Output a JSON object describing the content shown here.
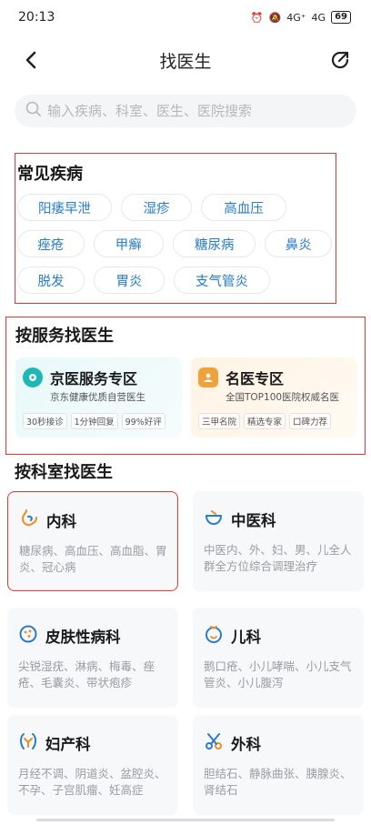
{
  "status_bar": {
    "time": "20:13",
    "battery": "69",
    "signal_a": "4G⁺",
    "signal_b": "4G"
  },
  "nav": {
    "title": "找医生"
  },
  "search": {
    "placeholder": "输入疾病、科室、医生、医院搜索"
  },
  "diseases": {
    "title": "常见疾病",
    "rows": [
      [
        "阳痿早泄",
        "湿疹",
        "高血压"
      ],
      [
        "痤疮",
        "甲癣",
        "糖尿病",
        "鼻炎"
      ],
      [
        "脱发",
        "胃炎",
        "支气管炎"
      ]
    ]
  },
  "service": {
    "title": "按服务找医生",
    "cards": [
      {
        "name": "京医服务专区",
        "sub": "京东健康优质自营医生",
        "tags": [
          "30秒接诊",
          "1分钟回复",
          "99%好评"
        ]
      },
      {
        "name": "名医专区",
        "sub": "全国TOP100医院权威名医",
        "tags": [
          "三甲名院",
          "精选专家",
          "口碑力荐"
        ]
      }
    ]
  },
  "departments": {
    "title": "按科室找医生",
    "items": [
      {
        "name": "内科",
        "desc": "糖尿病、高血压、高血脂、胃炎、冠心病",
        "icon": "stomach-icon"
      },
      {
        "name": "中医科",
        "desc": "中医内、外、妇、男、儿全人群全方位综合调理治疗",
        "icon": "herbal-bowl-icon"
      },
      {
        "name": "皮肤性病科",
        "desc": "尖锐湿疣、淋病、梅毒、痤疮、毛囊炎、带状疱疹",
        "icon": "skin-icon"
      },
      {
        "name": "儿科",
        "desc": "鹅口疮、小儿哮喘、小儿支气管炎、小儿腹泻",
        "icon": "child-face-icon"
      },
      {
        "name": "妇产科",
        "desc": "月经不调、阴道炎、盆腔炎、不孕、子宫肌瘤、妊高症",
        "icon": "uterus-icon"
      },
      {
        "name": "外科",
        "desc": "胆结石、静脉曲张、胰腺炎、肾结石",
        "icon": "scissors-icon"
      }
    ]
  },
  "colors": {
    "accent_blue": "#2a7cc7",
    "highlight_red": "#e53935",
    "dept_orange": "#f08a24"
  }
}
